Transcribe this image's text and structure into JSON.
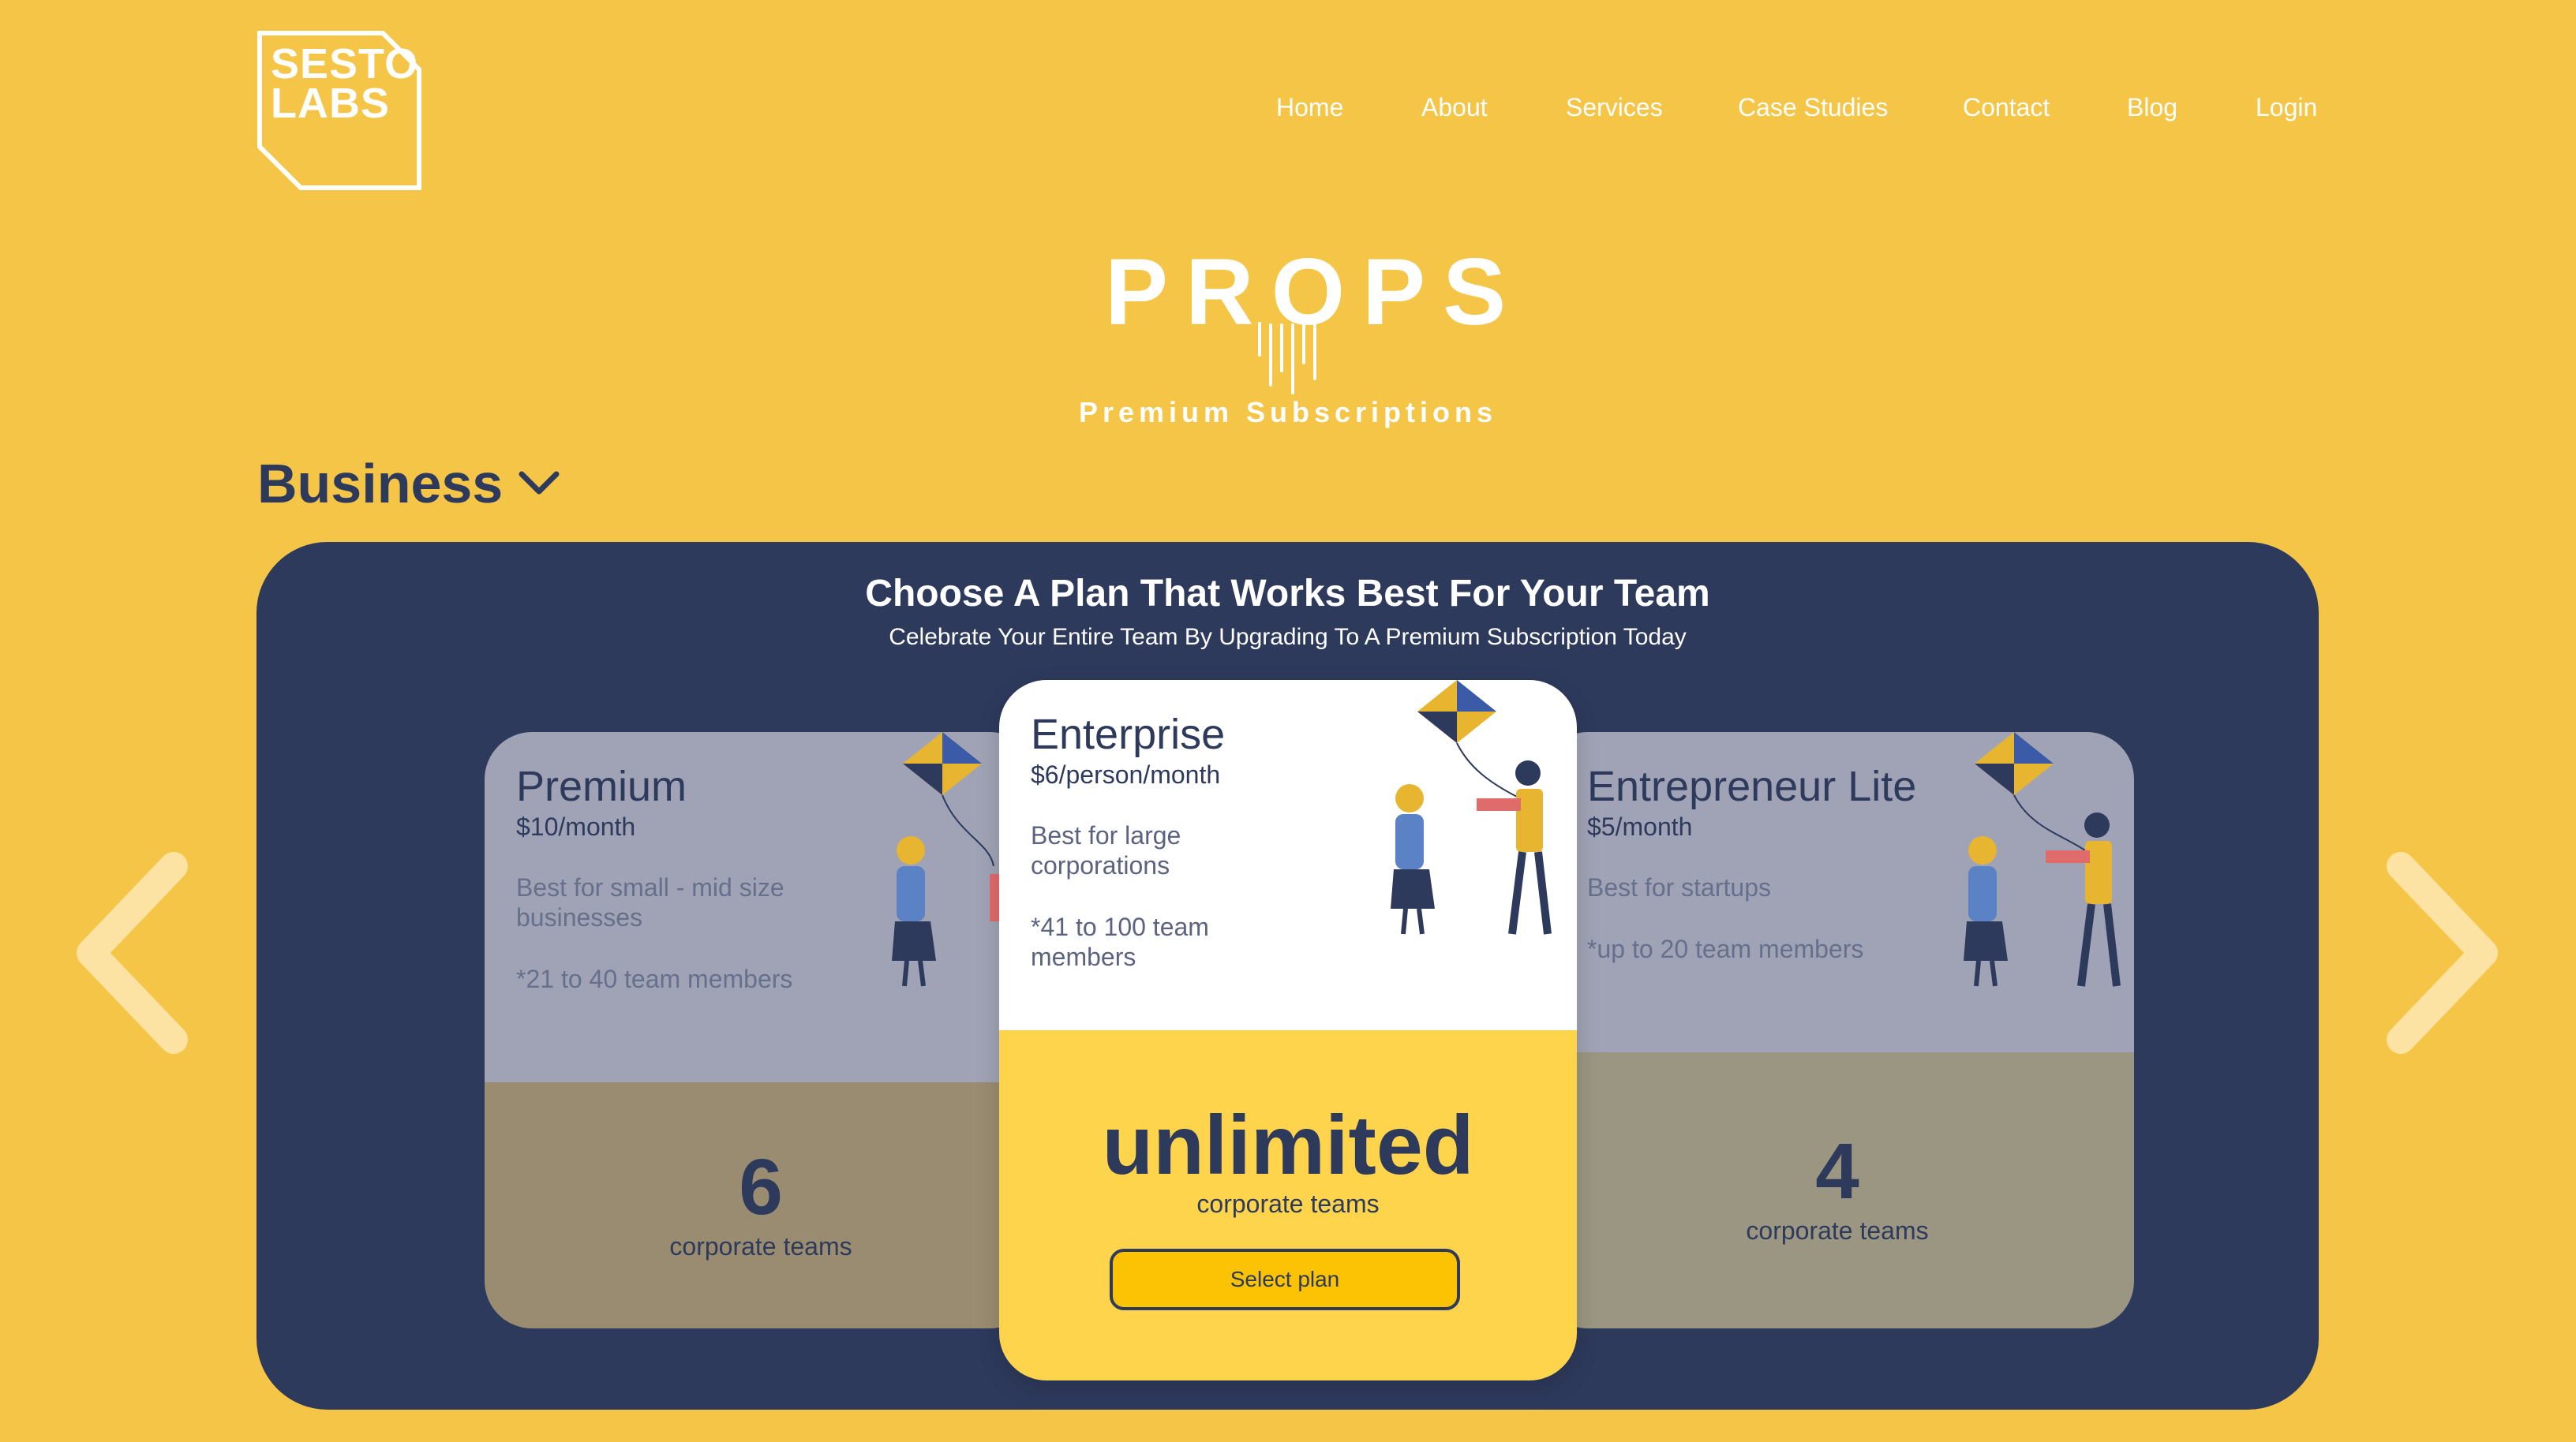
{
  "brand": {
    "logo_line1": "SESTO",
    "logo_line2": "LABS",
    "product_name": "PROPS",
    "product_tagline": "Premium Subscriptions"
  },
  "nav": {
    "items": [
      "Home",
      "About",
      "Services",
      "Case Studies",
      "Contact",
      "Blog",
      "Login"
    ]
  },
  "category": {
    "label": "Business"
  },
  "panel": {
    "title": "Choose A Plan That Works Best For Your Team",
    "subtitle": "Celebrate Your Entire Team By Upgrading To A Premium Subscription Today"
  },
  "plans": [
    {
      "name": "Premium",
      "price": "$10/month",
      "description": "Best for small - mid size businesses",
      "members": "*21 to 40 team members",
      "count": "6",
      "count_unit": "corporate teams"
    },
    {
      "name": "Enterprise",
      "price": "$6/person/month",
      "description": "Best for large corporations",
      "members": "*41 to 100 team members",
      "count": "unlimited",
      "count_unit": "corporate teams",
      "cta": "Select plan"
    },
    {
      "name": "Entrepreneur Lite",
      "price": "$5/month",
      "description": "Best for startups",
      "members": "*up to 20 team members",
      "count": "4",
      "count_unit": "corporate teams"
    }
  ],
  "colors": {
    "background": "#F5C547",
    "panel": "#2E3A5C",
    "accent_button": "#FCC204",
    "text_dark": "#2E3A5C"
  },
  "icons": {
    "category_toggle": "chevron-down-icon",
    "prev": "chevron-left-icon",
    "next": "chevron-right-icon",
    "plan_illustration": "kite-people-illustration"
  }
}
